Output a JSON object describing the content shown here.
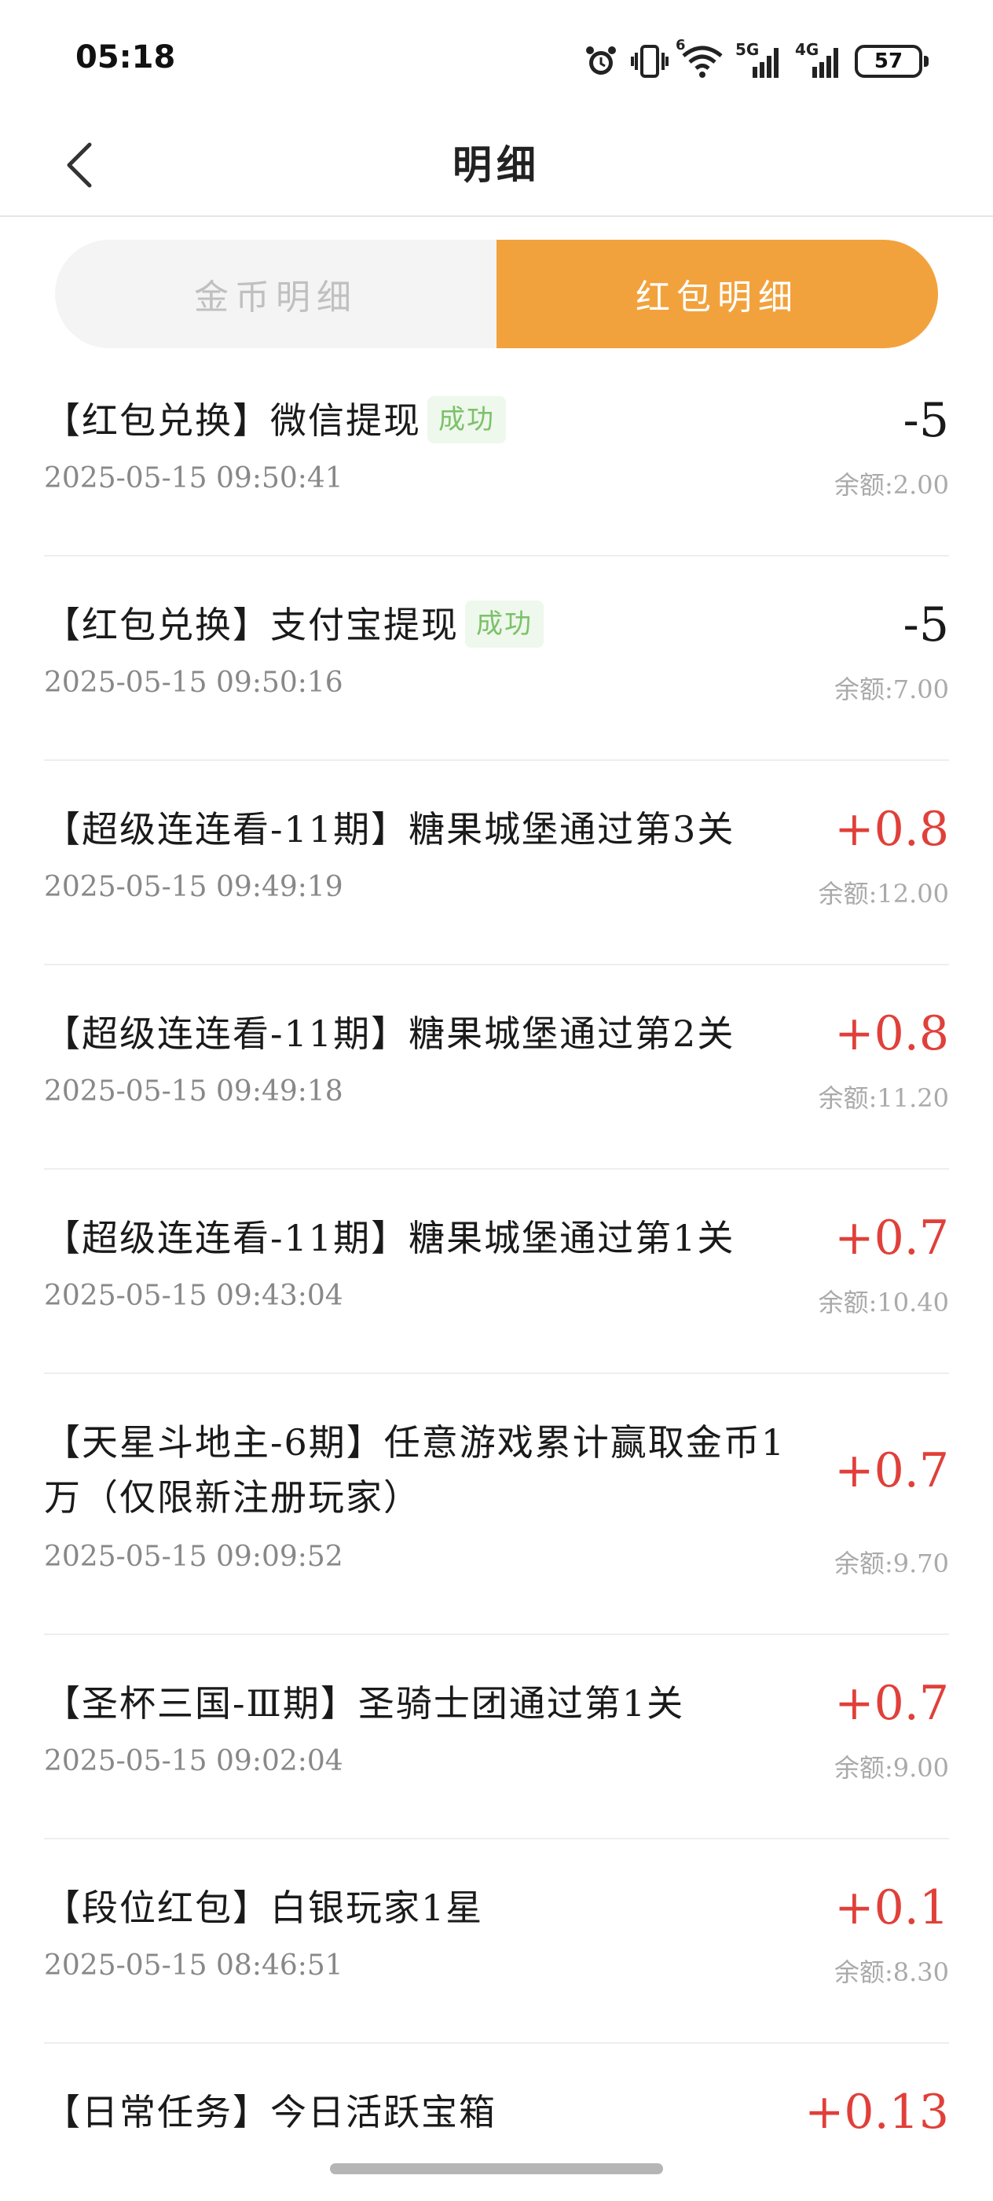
{
  "status_bar": {
    "time": "05:18",
    "signal_6_label": "6",
    "signal_5g_label": "5G",
    "signal_4g_label": "4G",
    "battery": "57"
  },
  "header": {
    "title": "明细"
  },
  "tabs": [
    {
      "label": "金币明细",
      "active": false
    },
    {
      "label": "红包明细",
      "active": true
    }
  ],
  "records": [
    {
      "title": "【红包兑换】微信提现",
      "badge": "成功",
      "time": "2025-05-15 09:50:41",
      "amount": "-5",
      "balance": "余额:2.00",
      "sign": "negative"
    },
    {
      "title": "【红包兑换】支付宝提现",
      "badge": "成功",
      "time": "2025-05-15 09:50:16",
      "amount": "-5",
      "balance": "余额:7.00",
      "sign": "negative"
    },
    {
      "title": "【超级连连看-11期】糖果城堡通过第3关",
      "badge": "",
      "time": "2025-05-15 09:49:19",
      "amount": "+0.8",
      "balance": "余额:12.00",
      "sign": "positive"
    },
    {
      "title": "【超级连连看-11期】糖果城堡通过第2关",
      "badge": "",
      "time": "2025-05-15 09:49:18",
      "amount": "+0.8",
      "balance": "余额:11.20",
      "sign": "positive"
    },
    {
      "title": "【超级连连看-11期】糖果城堡通过第1关",
      "badge": "",
      "time": "2025-05-15 09:43:04",
      "amount": "+0.7",
      "balance": "余额:10.40",
      "sign": "positive"
    },
    {
      "title": "【天星斗地主-6期】任意游戏累计赢取金币1万（仅限新注册玩家）",
      "badge": "",
      "time": "2025-05-15 09:09:52",
      "amount": "+0.7",
      "balance": "余额:9.70",
      "sign": "positive"
    },
    {
      "title": "【圣杯三国-Ⅲ期】圣骑士团通过第1关",
      "badge": "",
      "time": "2025-05-15 09:02:04",
      "amount": "+0.7",
      "balance": "余额:9.00",
      "sign": "positive"
    },
    {
      "title": "【段位红包】白银玩家1星",
      "badge": "",
      "time": "2025-05-15 08:46:51",
      "amount": "+0.1",
      "balance": "余额:8.30",
      "sign": "positive"
    },
    {
      "title": "【日常任务】今日活跃宝箱",
      "badge": "",
      "time": "",
      "amount": "+0.13",
      "balance": "",
      "sign": "positive"
    }
  ],
  "colors": {
    "accent": "#f2a23c",
    "positive": "#e0403a",
    "success_badge": "#7cc16a"
  }
}
